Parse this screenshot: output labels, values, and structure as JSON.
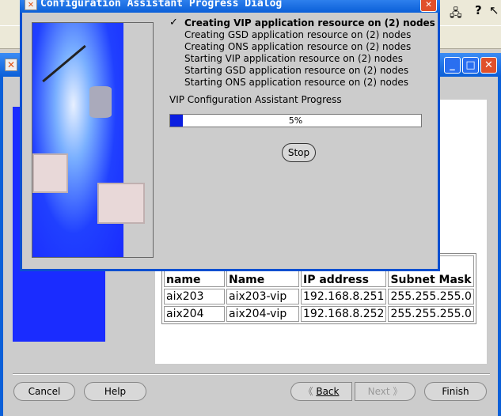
{
  "background_window": {
    "table": {
      "headers": [
        "name",
        "Name",
        "IP address",
        "Subnet Mask"
      ],
      "rows": [
        [
          "aix203",
          "aix203-vip",
          "192.168.8.251",
          "255.255.255.0"
        ],
        [
          "aix204",
          "aix204-vip",
          "192.168.8.252",
          "255.255.255.0"
        ]
      ]
    },
    "buttons": {
      "cancel": "Cancel",
      "help": "Help",
      "back": "Back",
      "next": "Next",
      "finish": "Finish"
    }
  },
  "dialog": {
    "title": "Configuration Assistant Progress Dialog",
    "tasks": [
      {
        "label": "Creating VIP application resource on (2) nodes",
        "status": "in-progress"
      },
      {
        "label": "Creating GSD application resource on (2) nodes",
        "status": "pending"
      },
      {
        "label": "Creating ONS application resource on (2) nodes",
        "status": "pending"
      },
      {
        "label": "Starting VIP application resource on (2) nodes",
        "status": "pending"
      },
      {
        "label": "Starting GSD application resource on (2) nodes",
        "status": "pending"
      },
      {
        "label": "Starting ONS application resource on (2) nodes",
        "status": "pending"
      }
    ],
    "progress_label": "VIP Configuration Assistant Progress",
    "progress_percent": 5,
    "progress_text": "5%",
    "stop": "Stop"
  }
}
